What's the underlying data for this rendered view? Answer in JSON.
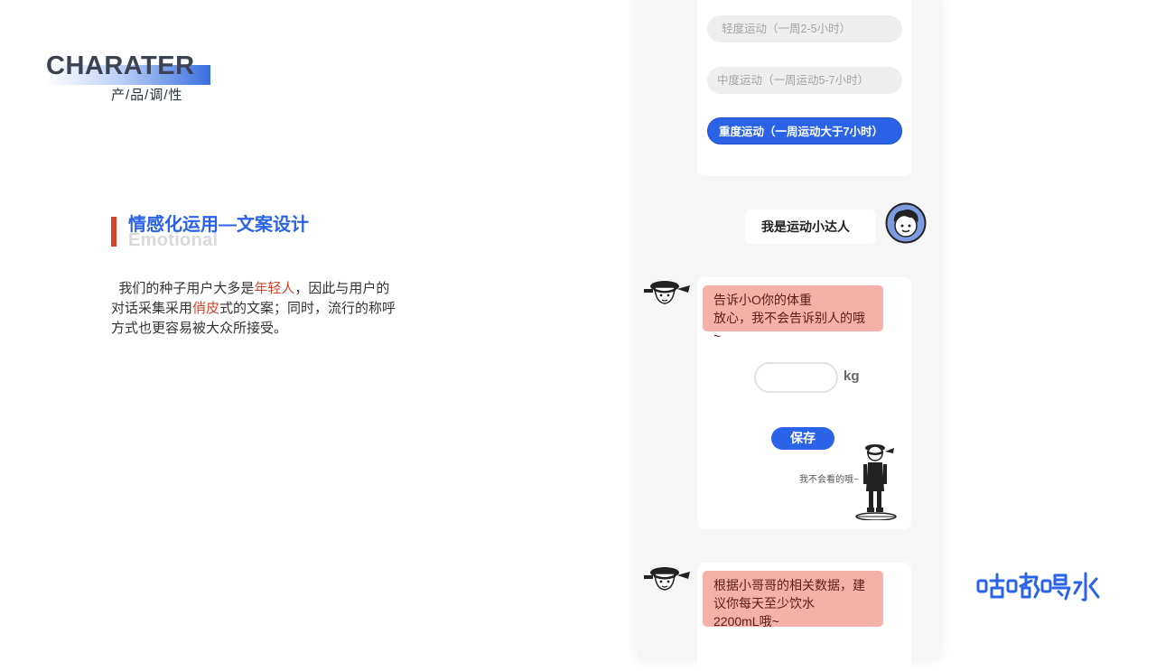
{
  "brand": {
    "title": "CHARATER",
    "subtitle": "产/品/调/性"
  },
  "section": {
    "title": "情感化运用—文案设计",
    "bg_word": "Emotional"
  },
  "intro": {
    "p1": "我们的种子用户大多是",
    "hl1": "年轻人",
    "p2": "，因此与用户的对话采集采用",
    "hl2": "俏皮",
    "p3": "式的文案；同时，流行的称呼方式也更容易被大众所接受。"
  },
  "phone": {
    "options": [
      {
        "label": "轻度运动（一周2-5小时）",
        "selected": false
      },
      {
        "label": "中度运动（一周运动5-7小时）",
        "selected": false
      },
      {
        "label": "重度运动（一周运动大于7小时）",
        "selected": true
      }
    ],
    "user_reply": "我是运动小达人",
    "bot_msg1": {
      "line1": "告诉小O你的体重",
      "line2": "放心，我不会告诉别人的哦~"
    },
    "weight": {
      "value": "",
      "unit": "kg"
    },
    "save_label": "保存",
    "whisper": "我不会看的哦~",
    "bot_msg2": {
      "line1": "根据小哥哥的相关数据，建",
      "line2": "议你每天至少饮水",
      "line3": "2200mL哦~"
    }
  },
  "logo_text": "咕嘟喝水",
  "colors": {
    "accent": "#2a62e8",
    "highlight": "#d6432b",
    "bubble": "#f3b1a7"
  }
}
